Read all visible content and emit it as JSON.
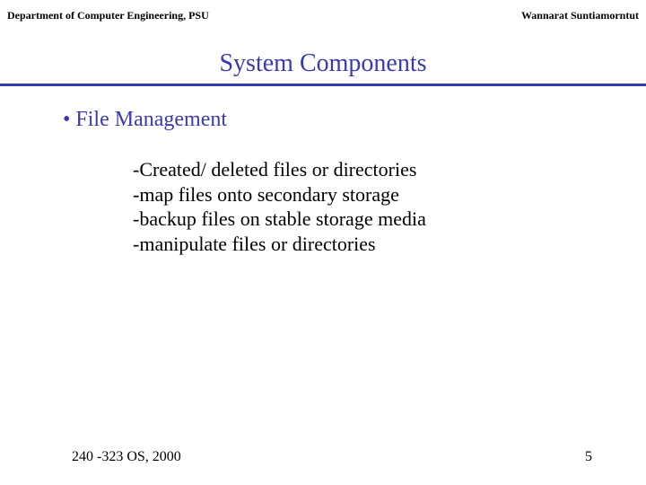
{
  "header": {
    "left": "Department of Computer Engineering, PSU",
    "right": "Wannarat  Suntiamorntut"
  },
  "title": "System Components",
  "bullet": "• File  Management",
  "items": [
    "-Created/ deleted files or  directories",
    "-map files onto secondary storage",
    "-backup files on stable storage media",
    "-manipulate files or directories"
  ],
  "footer": {
    "left": "240 -323  OS, 2000",
    "right": "5"
  }
}
